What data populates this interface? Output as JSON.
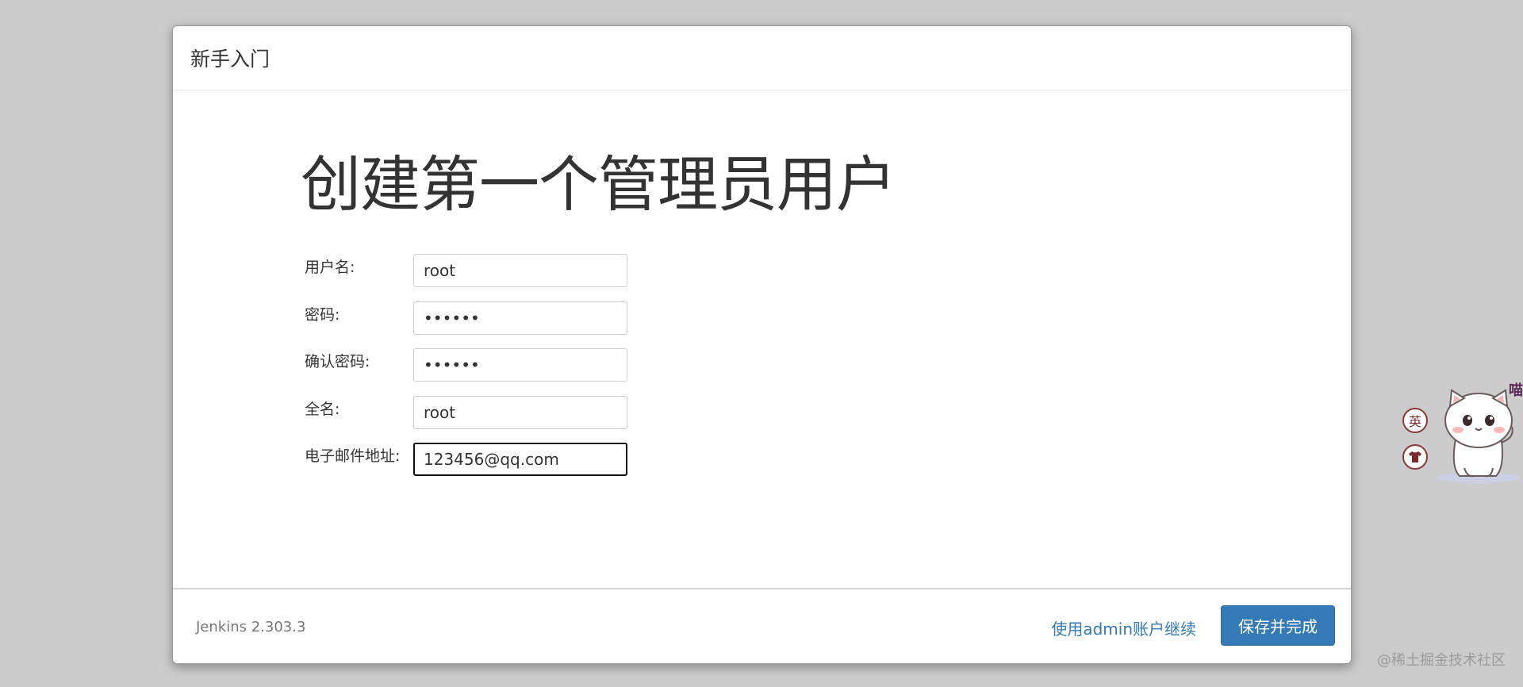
{
  "dialog": {
    "title": "新手入门",
    "heading": "创建第一个管理员用户"
  },
  "form": {
    "fields": [
      {
        "label": "用户名:",
        "value": "root",
        "type": "text"
      },
      {
        "label": "密码:",
        "value": "••••••",
        "type": "password"
      },
      {
        "label": "确认密码:",
        "value": "••••••",
        "type": "password"
      },
      {
        "label": "全名:",
        "value": "root",
        "type": "text"
      },
      {
        "label": "电子邮件地址:",
        "value": "123456@qq.com",
        "type": "email"
      }
    ]
  },
  "footer": {
    "version": "Jenkins 2.303.3",
    "continue_as_admin": "使用admin账户继续",
    "save_and_finish": "保存并完成"
  },
  "widget": {
    "lang_button": "英",
    "skin_icon": "shirt-icon",
    "speech": "喵"
  },
  "watermark": "@稀土掘金技术社区",
  "colors": {
    "backdrop": "#cccccc",
    "primary": "#337ab7",
    "text": "#333333"
  }
}
